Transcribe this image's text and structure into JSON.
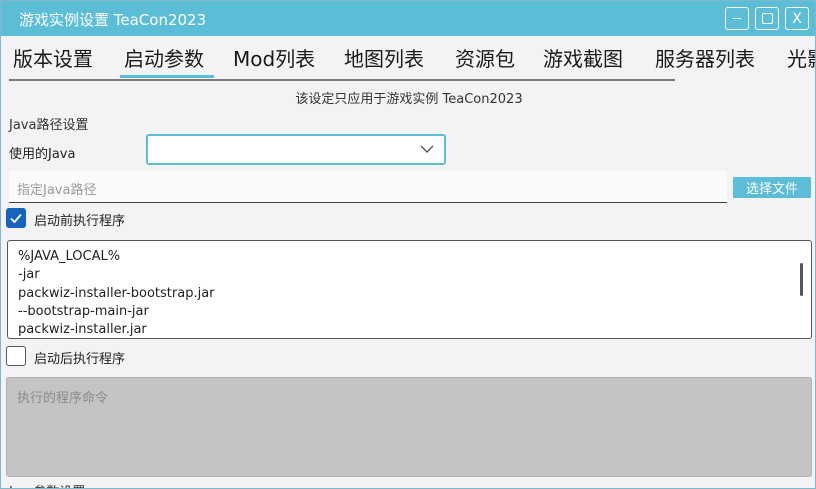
{
  "window": {
    "title": "游戏实例设置 TeaCon2023"
  },
  "window_controls": {
    "minimize": "-",
    "maximize": "□",
    "close": "X"
  },
  "tabs": [
    {
      "label": "版本设置"
    },
    {
      "label": "启动参数",
      "selected": true
    },
    {
      "label": "Mod列表"
    },
    {
      "label": "地图列表"
    },
    {
      "label": "资源包"
    },
    {
      "label": "游戏截图"
    },
    {
      "label": "服务器列表"
    },
    {
      "label": "光影"
    }
  ],
  "notice": "该设定只应用于游戏实例 TeaCon2023",
  "java": {
    "section_label": "Java路径设置",
    "select_label": "使用的Java",
    "select_value": "",
    "path_placeholder": "指定Java路径",
    "choose_file_label": "选择文件"
  },
  "pre_launch": {
    "label": "启动前执行程序",
    "checked": true,
    "lines": [
      "%JAVA_LOCAL%",
      "-jar",
      "packwiz-installer-bootstrap.jar",
      "--bootstrap-main-jar",
      "packwiz-installer.jar"
    ]
  },
  "post_launch": {
    "label": "启动后执行程序",
    "checked": false,
    "placeholder": "执行的程序命令"
  },
  "next_section_label": "Jvm参数设置",
  "colors": {
    "accent": "#5bbdd6",
    "checkbox": "#1565c0",
    "disabled_field": "#c4c4c4"
  }
}
